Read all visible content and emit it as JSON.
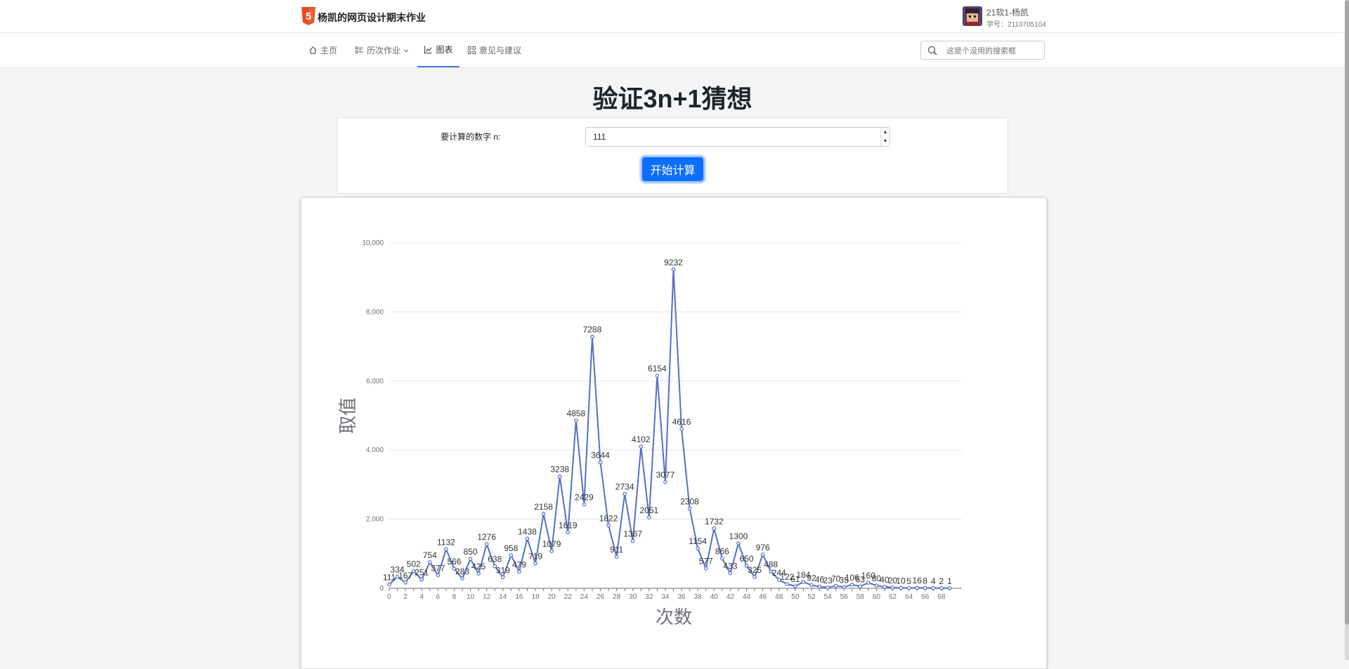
{
  "header": {
    "site_title": "杨凯的网页设计期末作业",
    "user_name": "21软1-杨凯",
    "user_id": "学号：2110705104",
    "logo_icon": "html5-logo-icon",
    "avatar_icon": "user-avatar"
  },
  "nav": {
    "items": [
      {
        "label": "主页",
        "icon": "home-icon"
      },
      {
        "label": "历次作业",
        "icon": "list-icon"
      },
      {
        "label": "图表",
        "icon": "chart-line-icon"
      },
      {
        "label": "意见与建议",
        "icon": "apps-icon"
      }
    ],
    "active": "图表"
  },
  "search": {
    "placeholder": "这是个没用的搜索框"
  },
  "page": {
    "heading": "验证3n+1猜想",
    "form_label": "要计算的数字 n:",
    "input_value": "111",
    "button_label": "开始计算"
  },
  "colors": {
    "accent": "#0d6efd",
    "series": "#5470c6",
    "nav_active": "#3a7bd5"
  },
  "chart_data": {
    "type": "line",
    "xlabel": "次数",
    "ylabel": "取值",
    "ylim": [
      0,
      10000
    ],
    "yticks": [
      "0",
      "2,000",
      "4,000",
      "6,000",
      "8,000",
      "10,000"
    ],
    "x": [
      0,
      1,
      2,
      3,
      4,
      5,
      6,
      7,
      8,
      9,
      10,
      11,
      12,
      13,
      14,
      15,
      16,
      17,
      18,
      19,
      20,
      21,
      22,
      23,
      24,
      25,
      26,
      27,
      28,
      29,
      30,
      31,
      32,
      33,
      34,
      35,
      36,
      37,
      38,
      39,
      40,
      41,
      42,
      43,
      44,
      45,
      46,
      47,
      48,
      49,
      50,
      51,
      52,
      53,
      54,
      55,
      56,
      57,
      58,
      59,
      60,
      61,
      62,
      63,
      64,
      65,
      66,
      67,
      68,
      69
    ],
    "series": [
      {
        "values": [
          111,
          334,
          167,
          502,
          251,
          754,
          377,
          1132,
          566,
          283,
          850,
          425,
          1276,
          638,
          319,
          958,
          479,
          1438,
          719,
          2158,
          1079,
          3238,
          1619,
          4858,
          2429,
          7288,
          3644,
          1822,
          911,
          2734,
          1367,
          4102,
          2051,
          6154,
          3077,
          9232,
          4616,
          2308,
          1154,
          577,
          1732,
          866,
          433,
          1300,
          650,
          325,
          976,
          488,
          244,
          122,
          61,
          184,
          92,
          46,
          23,
          70,
          35,
          106,
          53,
          160,
          80,
          40,
          20,
          10,
          5,
          16,
          8,
          4,
          2,
          1
        ]
      }
    ],
    "grid": true,
    "data_labels": true
  }
}
